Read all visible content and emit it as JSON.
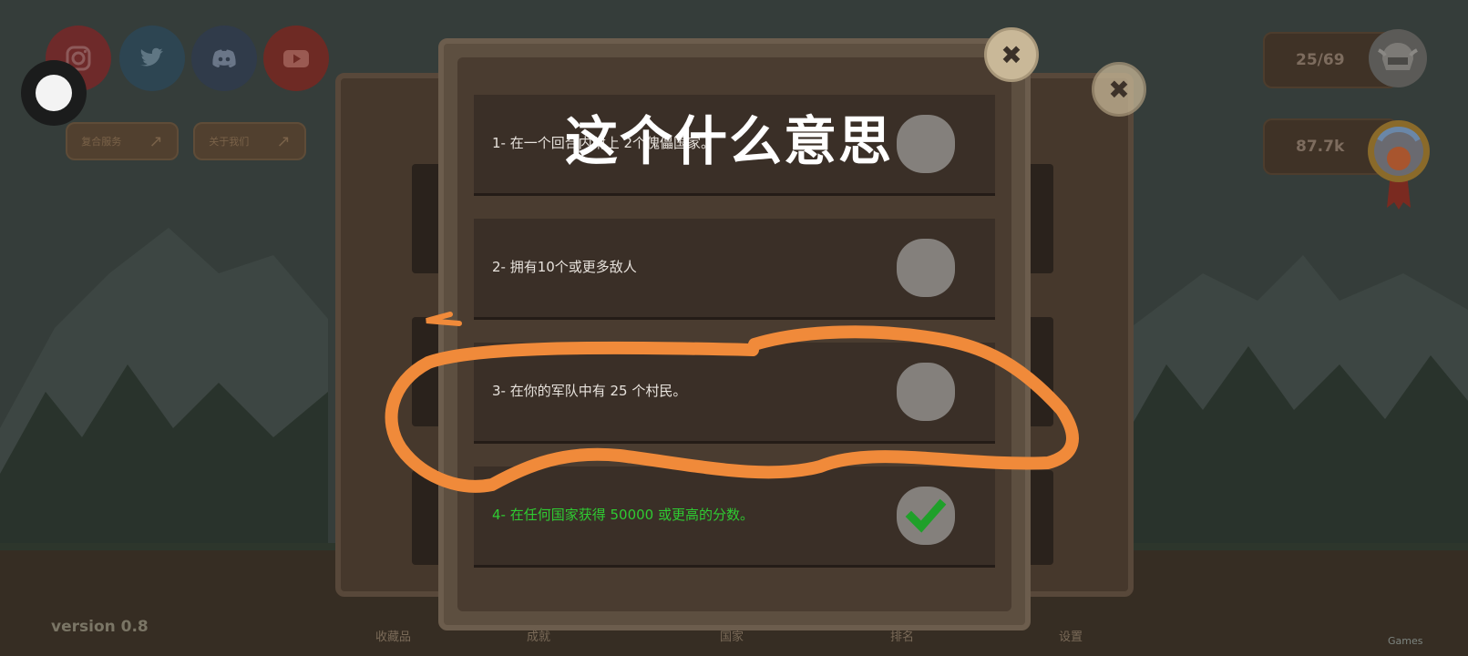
{
  "caption": "这个什么意思",
  "social": [
    {
      "name": "instagram-icon",
      "color": "#6e2a2a"
    },
    {
      "name": "twitter-icon",
      "color": "#2d4552"
    },
    {
      "name": "discord-icon",
      "color": "#303b4a"
    },
    {
      "name": "youtube-icon",
      "color": "#6e2a24"
    }
  ],
  "small_buttons": [
    {
      "label": "复合服务"
    },
    {
      "label": "关于我们"
    }
  ],
  "counters": {
    "progress": "25/69",
    "score": "87.7k"
  },
  "tasks": [
    {
      "text": "1- 在一个回合内附上 2个傀儡国家。",
      "done": false
    },
    {
      "text": "2- 拥有10个或更多敌人",
      "done": false
    },
    {
      "text": "3- 在你的军队中有 25 个村民。",
      "done": false
    },
    {
      "text": "4- 在任何国家获得 50000 或更高的分数。",
      "done": true
    }
  ],
  "nav": [
    "收藏品",
    "成就",
    "国家",
    "排名",
    "设置"
  ],
  "version": "version 0.8",
  "watermark": "Games",
  "colors": {
    "highlight": "#f08a3a",
    "done_text": "#2fcb32",
    "check": "#1fa02a"
  }
}
